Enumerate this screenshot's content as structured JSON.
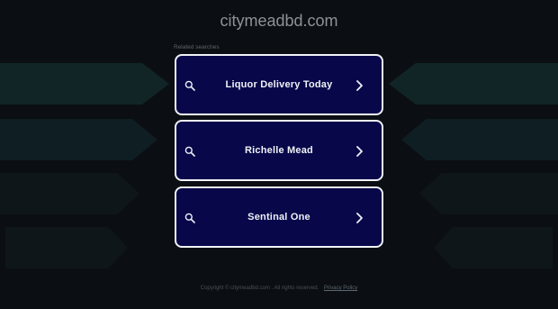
{
  "header": {
    "domain": "citymeadbd.com"
  },
  "related": {
    "label": "Related searches",
    "items": [
      {
        "label": "Liquor Delivery Today"
      },
      {
        "label": "Richelle Mead"
      },
      {
        "label": "Sentinal One"
      }
    ]
  },
  "footer": {
    "copyright": "Copyright © citymeadbd.com . All rights reserved.",
    "privacy": "Privacy Policy"
  },
  "colors": {
    "background": "#0b0f13",
    "card_fill": "#07074a",
    "card_border": "#f0f2f6",
    "bg_shape_teal": "#132a2c",
    "bg_shape_slate": "#1a2730"
  },
  "icons": {
    "search": "search-icon",
    "chevron": "chevron-right-icon"
  }
}
